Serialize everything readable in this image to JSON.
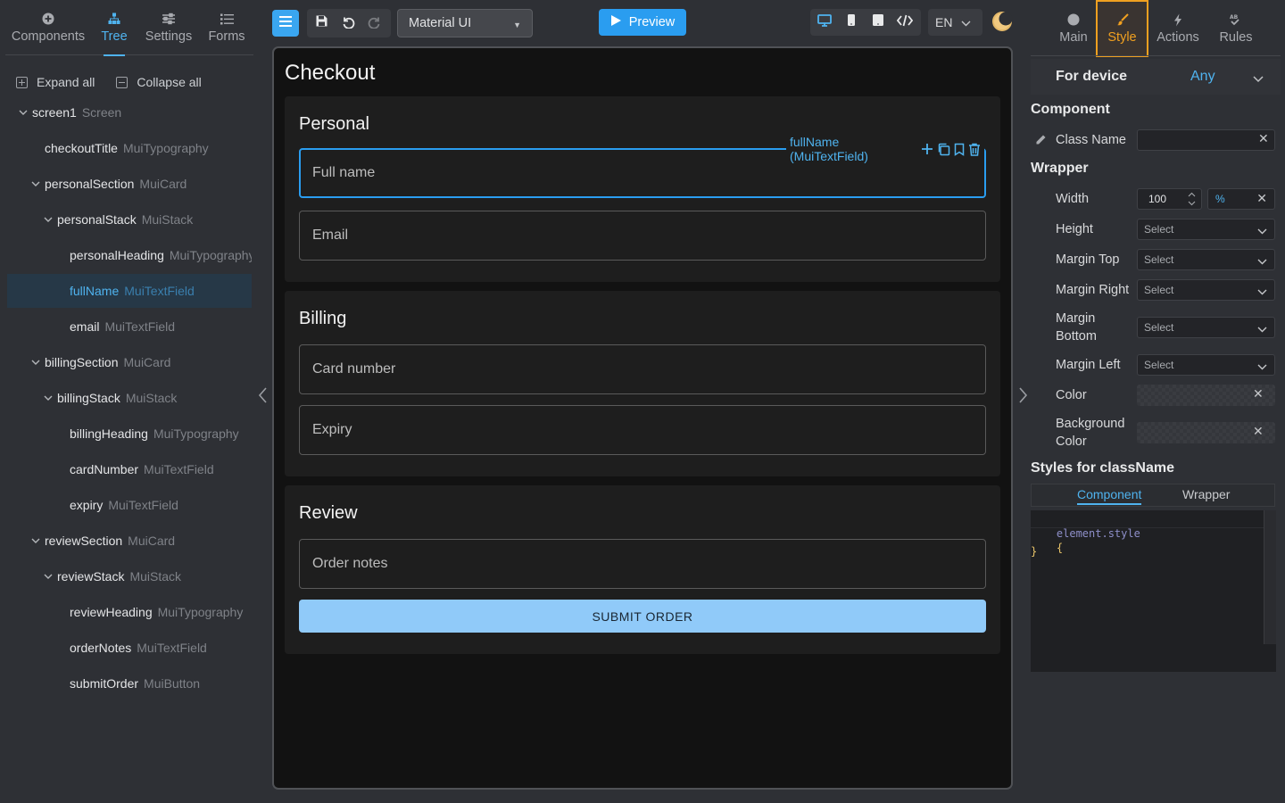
{
  "left_tabs": [
    {
      "label": "Components",
      "icon": "plus-circle-icon"
    },
    {
      "label": "Tree",
      "icon": "tree-icon",
      "active": true
    },
    {
      "label": "Settings",
      "icon": "sliders-icon"
    },
    {
      "label": "Forms",
      "icon": "list-icon"
    }
  ],
  "tree_actions": {
    "expand_all": "Expand all",
    "collapse_all": "Collapse all"
  },
  "tree": [
    {
      "name": "screen1",
      "type": "Screen",
      "expandable": true
    },
    {
      "name": "checkoutTitle",
      "type": "MuiTypography"
    },
    {
      "name": "personalSection",
      "type": "MuiCard",
      "expandable": true
    },
    {
      "name": "personalStack",
      "type": "MuiStack",
      "expandable": true
    },
    {
      "name": "personalHeading",
      "type": "MuiTypography"
    },
    {
      "name": "fullName",
      "type": "MuiTextField",
      "selected": true
    },
    {
      "name": "email",
      "type": "MuiTextField"
    },
    {
      "name": "billingSection",
      "type": "MuiCard",
      "expandable": true
    },
    {
      "name": "billingStack",
      "type": "MuiStack",
      "expandable": true
    },
    {
      "name": "billingHeading",
      "type": "MuiTypography"
    },
    {
      "name": "cardNumber",
      "type": "MuiTextField"
    },
    {
      "name": "expiry",
      "type": "MuiTextField"
    },
    {
      "name": "reviewSection",
      "type": "MuiCard",
      "expandable": true
    },
    {
      "name": "reviewStack",
      "type": "MuiStack",
      "expandable": true
    },
    {
      "name": "reviewHeading",
      "type": "MuiTypography"
    },
    {
      "name": "orderNotes",
      "type": "MuiTextField"
    },
    {
      "name": "submitOrder",
      "type": "MuiButton"
    }
  ],
  "toolbar": {
    "library": "Material UI",
    "preview_label": "Preview",
    "language": "EN"
  },
  "canvas": {
    "title": "Checkout",
    "personal": {
      "heading": "Personal",
      "full_name": "Full name",
      "email": "Email"
    },
    "billing": {
      "heading": "Billing",
      "card_number": "Card number",
      "expiry": "Expiry"
    },
    "review": {
      "heading": "Review",
      "order_notes": "Order notes",
      "submit": "SUBMIT ORDER"
    },
    "selection_label": "fullName (MuiTextField)"
  },
  "right_tabs": [
    {
      "label": "Main",
      "icon": "circle-icon"
    },
    {
      "label": "Style",
      "icon": "brush-icon",
      "active": true
    },
    {
      "label": "Actions",
      "icon": "lightning-icon"
    },
    {
      "label": "Rules",
      "icon": "rules-icon"
    }
  ],
  "style_panel": {
    "for_device_label": "For device",
    "for_device_value": "Any",
    "component_title": "Component",
    "class_name_label": "Class Name",
    "class_name_value": "",
    "wrapper_title": "Wrapper",
    "width_label": "Width",
    "width_value": "100",
    "width_unit": "%",
    "height_label": "Height",
    "margin_top_label": "Margin Top",
    "margin_right_label": "Margin Right",
    "margin_bottom_label": "Margin Bottom",
    "margin_left_label": "Margin Left",
    "select_placeholder": "Select",
    "color_label": "Color",
    "background_color_label": "Background Color",
    "styles_title": "Styles for className",
    "styles_tabs": [
      "Component",
      "Wrapper"
    ],
    "code_line1_selector": "element.style",
    "code_open": "{",
    "code_close": "}"
  },
  "colors": {
    "accent": "#4fb3ef",
    "active_tab": "#f0a020",
    "primary_button": "#90caf9",
    "preview_button": "#2a9df0"
  }
}
